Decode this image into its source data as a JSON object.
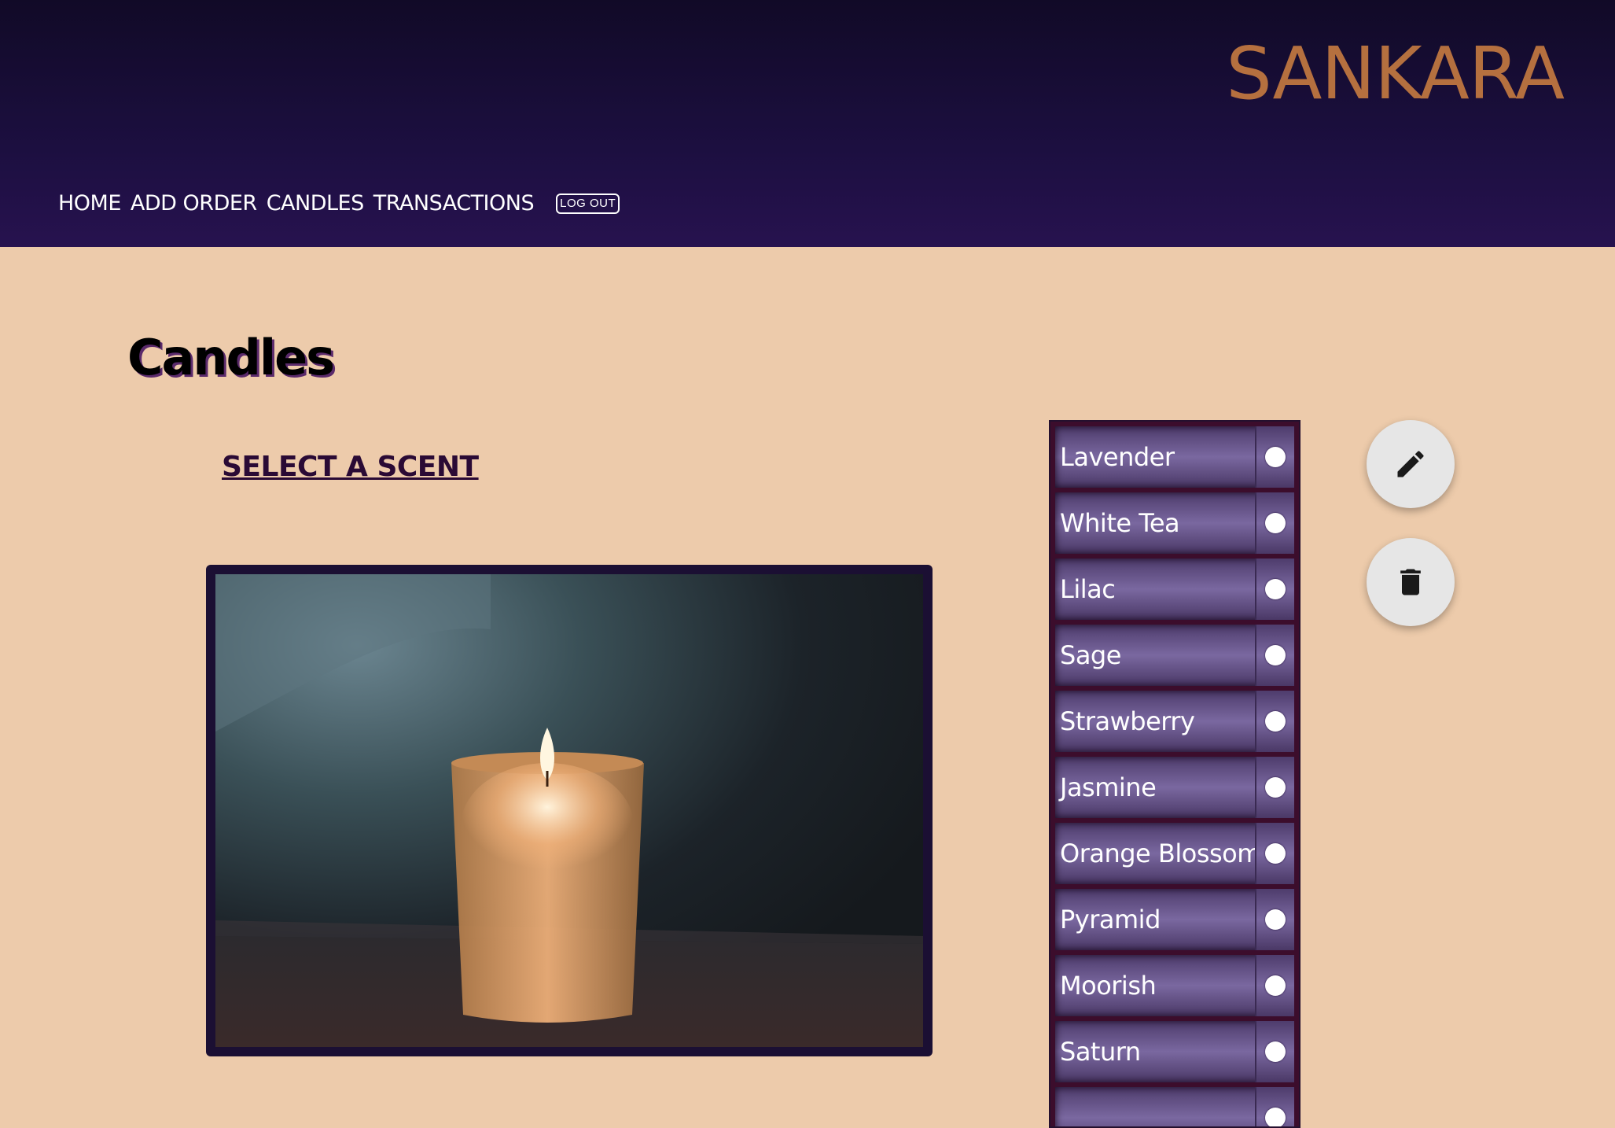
{
  "header": {
    "brand": "SANKARA",
    "nav": [
      "HOME",
      "ADD ORDER",
      "CANDLES",
      "TRANSACTIONS"
    ],
    "logout_label": "LOG OUT"
  },
  "main": {
    "title": "Candles",
    "select_scent_label": "SELECT A SCENT"
  },
  "scents": [
    "Lavender",
    "White Tea",
    "Lilac",
    "Sage",
    "Strawberry",
    "Jasmine",
    "Orange Blossom",
    "Pyramid",
    "Moorish",
    "Saturn"
  ],
  "actions": {
    "edit_icon": "pencil-icon",
    "delete_icon": "trash-icon"
  },
  "colors": {
    "header_bg": "#1c0f40",
    "page_bg": "#edcbab",
    "brand": "#b5703f",
    "scent_row": "#7a68a0"
  }
}
